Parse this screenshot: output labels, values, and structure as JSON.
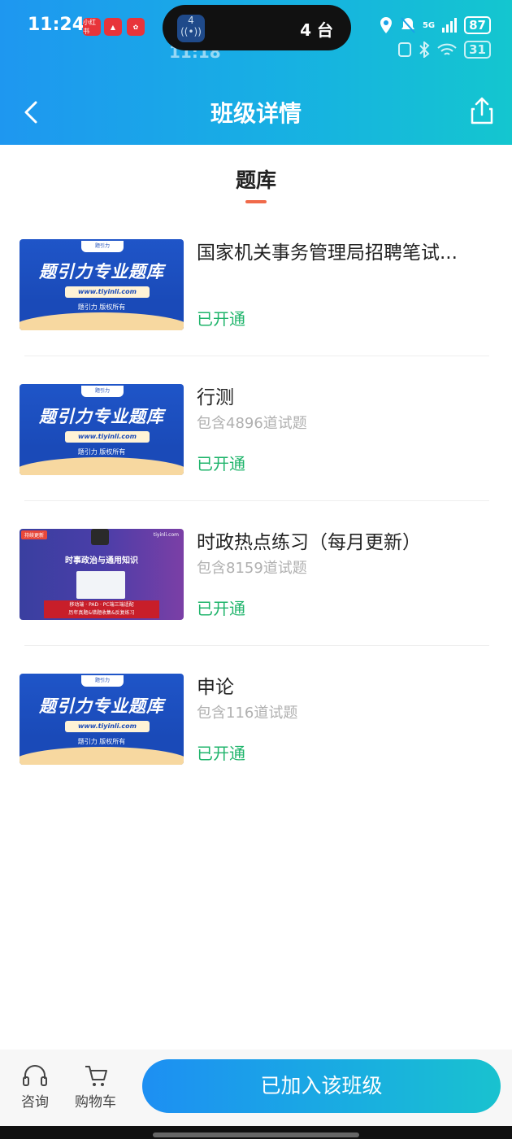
{
  "status_bar": {
    "time": "11:24",
    "ghost_time": "11:18",
    "pill_icon_label": "4",
    "pill_text": "4 台",
    "signal_label": "5G",
    "battery": "87",
    "battery_ghost": "31",
    "app_badges": [
      {
        "label": "小红书",
        "color": "#e8343a"
      },
      {
        "label": "▲",
        "color": "#e8343a"
      },
      {
        "label": "✿",
        "color": "#e8343a"
      }
    ]
  },
  "nav": {
    "title": "班级详情"
  },
  "tab": {
    "label": "题库"
  },
  "items": [
    {
      "title": "国家机关事务管理局招聘笔试...",
      "count": "",
      "status": "已开通",
      "thumb": "blue",
      "thumb_title": "题引力专业题库",
      "thumb_url": "www.tiyinli.com",
      "thumb_copy": "题引力 版权所有",
      "thumb_logo": "题引力"
    },
    {
      "title": "行测",
      "count": "包含4896道试题",
      "status": "已开通",
      "thumb": "blue",
      "thumb_title": "题引力专业题库",
      "thumb_url": "www.tiyinli.com",
      "thumb_copy": "题引力 版权所有",
      "thumb_logo": "题引力"
    },
    {
      "title": "时政热点练习（每月更新）",
      "count": "包含8159道试题",
      "status": "已开通",
      "thumb": "purple",
      "thumb_tag": "持续更新",
      "thumb_site": "tiyinli.com",
      "thumb_head": "时事政治与通用知识",
      "thumb_red_1": "移动端 · PAD · PC端三端适配",
      "thumb_red_2": "历年真题&错题收集&反复练习"
    },
    {
      "title": "申论",
      "count": "包含116道试题",
      "status": "已开通",
      "thumb": "blue",
      "thumb_title": "题引力专业题库",
      "thumb_url": "www.tiyinli.com",
      "thumb_copy": "题引力 版权所有",
      "thumb_logo": "题引力"
    }
  ],
  "bottom": {
    "consult_label": "咨询",
    "cart_label": "购物车",
    "join_label": "已加入该班级"
  }
}
